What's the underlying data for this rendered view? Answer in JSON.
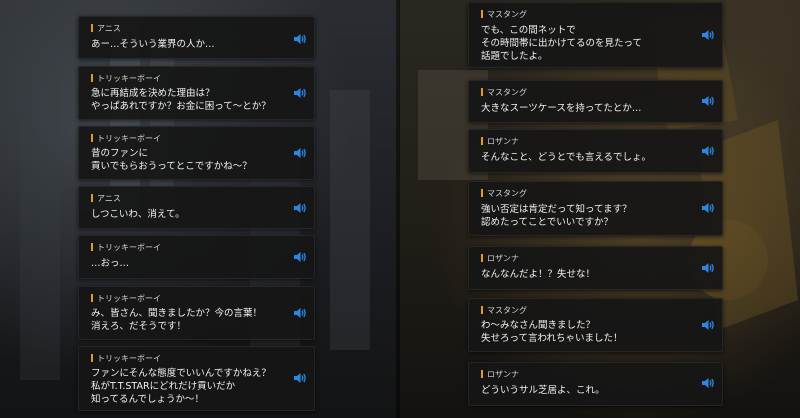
{
  "colors": {
    "speaker_bar": "#e09a28",
    "voice_icon": "#2b86e8",
    "bubble_bg": "#161616"
  },
  "left_dialogue": [
    {
      "speaker": "アニス",
      "lines": [
        "あー…そういう業界の人か…"
      ]
    },
    {
      "speaker": "トリッキーボーイ",
      "lines": [
        "急に再結成を決めた理由は？",
        "やっぱあれですか？お金に困って～とか？"
      ]
    },
    {
      "speaker": "トリッキーボーイ",
      "lines": [
        "昔のファンに",
        "貢いでもらおうってとこですかね～？"
      ]
    },
    {
      "speaker": "アニス",
      "lines": [
        "しつこいわ、消えて。"
      ]
    },
    {
      "speaker": "トリッキーボーイ",
      "lines": [
        "…おっ…"
      ]
    },
    {
      "speaker": "トリッキーボーイ",
      "lines": [
        "み、皆さん、聞きましたか？今の言葉！",
        "消えろ、だそうです！"
      ]
    },
    {
      "speaker": "トリッキーボーイ",
      "lines": [
        "ファンにそんな態度でいいんですかねえ？",
        "私がT.T.STARにどれだけ貢いだか",
        "知ってるんでしょうか～！"
      ]
    }
  ],
  "right_dialogue": [
    {
      "speaker": "マスタング",
      "lines": [
        "でも、この間ネットで",
        "その時間帯に出かけてるのを見たって",
        "話題でしたよ。"
      ]
    },
    {
      "speaker": "マスタング",
      "lines": [
        "大きなスーツケースを持ってたとか…"
      ]
    },
    {
      "speaker": "ロザンナ",
      "lines": [
        "そんなこと、どうとでも言えるでしょ。"
      ]
    },
    {
      "speaker": "マスタング",
      "lines": [
        "強い否定は肯定だって知ってます？",
        "認めたってことでいいですか？"
      ]
    },
    {
      "speaker": "ロザンナ",
      "lines": [
        "なんなんだよ！？失せな！"
      ]
    },
    {
      "speaker": "マスタング",
      "lines": [
        "わ～みなさん聞きました？",
        "失せろって言われちゃいました！"
      ]
    },
    {
      "speaker": "ロザンナ",
      "lines": [
        "どういうサル芝居よ、これ。"
      ]
    }
  ]
}
